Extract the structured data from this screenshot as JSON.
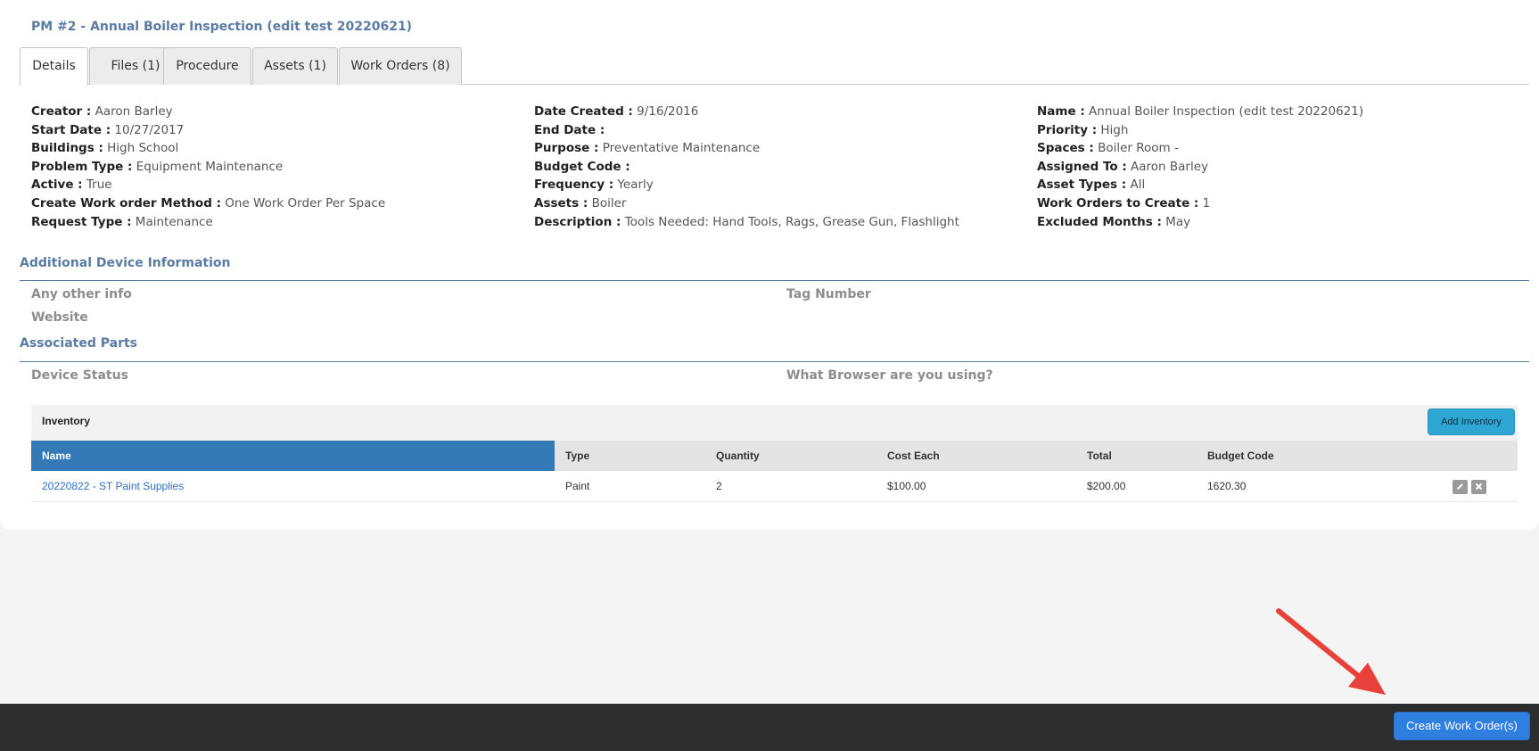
{
  "pm": {
    "title": "PM #2 - Annual Boiler Inspection (edit test 20220621)"
  },
  "tabs": [
    {
      "label": "Details"
    },
    {
      "label": "Files (1)"
    },
    {
      "label": "Procedure"
    },
    {
      "label": "Assets (1)"
    },
    {
      "label": "Work Orders (8)"
    }
  ],
  "details": {
    "col1": [
      {
        "label": "Creator :",
        "value": "Aaron Barley"
      },
      {
        "label": "Start Date :",
        "value": "10/27/2017"
      },
      {
        "label": "Buildings :",
        "value": "High School"
      },
      {
        "label": "Problem Type :",
        "value": "Equipment Maintenance"
      },
      {
        "label": "Active :",
        "value": "True"
      },
      {
        "label": "Create Work order Method :",
        "value": "One Work Order Per Space"
      },
      {
        "label": "Request Type :",
        "value": "Maintenance"
      }
    ],
    "col2": [
      {
        "label": "Date Created :",
        "value": "9/16/2016"
      },
      {
        "label": "End Date :",
        "value": ""
      },
      {
        "label": "Purpose :",
        "value": "Preventative Maintenance"
      },
      {
        "label": "Budget Code :",
        "value": ""
      },
      {
        "label": "Frequency :",
        "value": "Yearly"
      },
      {
        "label": "Assets :",
        "value": "Boiler"
      },
      {
        "label": "Description :",
        "value": "Tools Needed: Hand Tools, Rags, Grease Gun, Flashlight"
      }
    ],
    "col3": [
      {
        "label": "Name :",
        "value": "Annual Boiler Inspection (edit test 20220621)"
      },
      {
        "label": "Priority :",
        "value": "High"
      },
      {
        "label": "Spaces :",
        "value": "Boiler Room -"
      },
      {
        "label": "Assigned To :",
        "value": "Aaron Barley"
      },
      {
        "label": "Asset Types :",
        "value": "All"
      },
      {
        "label": "Work Orders to Create :",
        "value": "1"
      },
      {
        "label": "Excluded Months :",
        "value": "May"
      }
    ]
  },
  "additional": {
    "title": "Additional Device Information",
    "fields": [
      "Any other info",
      "Tag Number",
      "Website"
    ]
  },
  "associated": {
    "title": "Associated Parts",
    "fields": [
      "Device Status",
      "What Browser are you using?"
    ]
  },
  "inventory": {
    "title": "Inventory",
    "add_label": "Add Inventory",
    "columns": [
      "Name",
      "Type",
      "Quantity",
      "Cost Each",
      "Total",
      "Budget Code"
    ],
    "rows": [
      {
        "name": "20220822 - ST Paint Supplies",
        "type": "Paint",
        "quantity": "2",
        "cost_each": "$100.00",
        "total": "$200.00",
        "budget_code": "1620.30"
      }
    ]
  },
  "footer": {
    "create_label": "Create Work Order(s)"
  },
  "colors": {
    "accent": "#5a7ba3",
    "primary": "#337ab7",
    "create_button": "#2f7fe0",
    "annotation_arrow": "#e8413a"
  }
}
